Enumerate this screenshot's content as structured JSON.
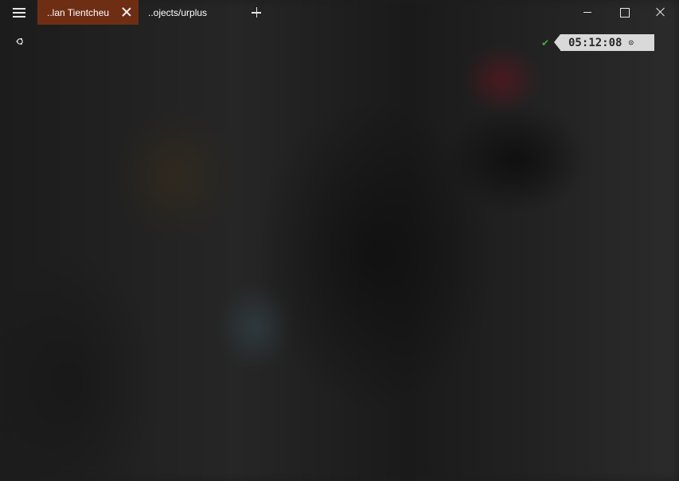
{
  "window": {
    "tabs": [
      {
        "label": "..lan Tientcheu",
        "active": true
      },
      {
        "label": "..ojects/urplus",
        "active": false
      }
    ],
    "active_tab_color": "#6e2e14"
  },
  "terminal": {
    "prompt_icon": "ubuntu-icon",
    "status_icon": "check-icon",
    "time": "05:12:08",
    "time_icon": "clock-icon",
    "status_color": "#3fae3a"
  }
}
